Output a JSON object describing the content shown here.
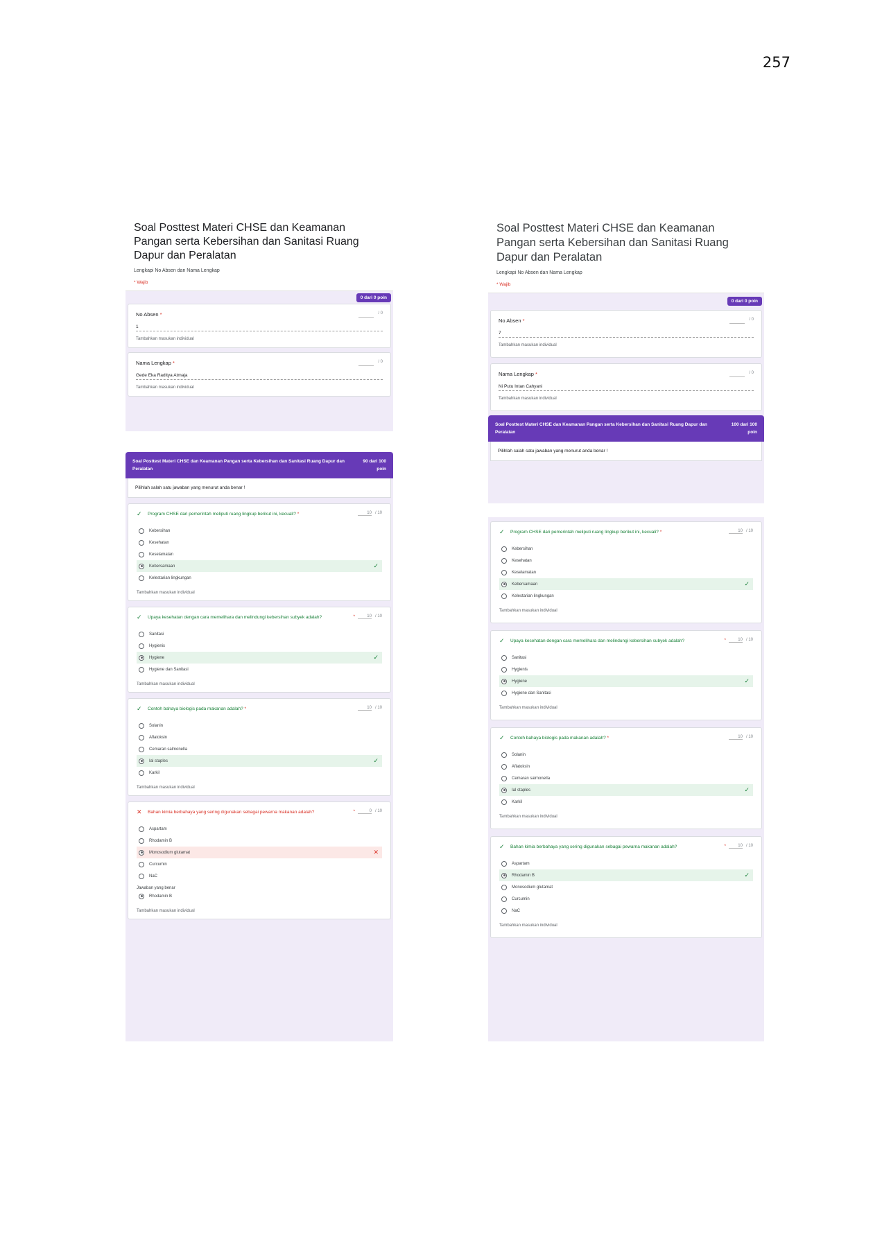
{
  "page_number": "257",
  "left": {
    "form_title": "Soal Posttest  Materi CHSE dan Keamanan Pangan serta Kebersihan dan Sanitasi Ruang Dapur dan Peralatan",
    "form_desc": "Lengkapi No Absen dan Nama Lengkap",
    "wajib": "* Wajib",
    "points_badge": "0 dari 0 poin",
    "no_absen": {
      "label": "No Absen",
      "req": "*",
      "score": "",
      "max": "/ 0",
      "value": "1",
      "feedback": "Tambahkan masukan individual"
    },
    "nama": {
      "label": "Nama Lengkap",
      "req": "*",
      "score": "",
      "max": "/ 0",
      "value": "Gede Eka Raditya Atmaja",
      "feedback": "Tambahkan masukan individual"
    },
    "section": {
      "title": "Soal Posttest  Materi CHSE dan Keamanan Pangan serta Kebersihan dan Sanitasi Ruang Dapur dan Peralatan",
      "points": "90 dari 100 poin",
      "desc": "Pilihlah salah satu jawaban yang menurut anda benar !"
    },
    "questions": [
      {
        "mark": "✓",
        "text": "Program CHSE dari pemerintah meliputi ruang lingkup berikut ini, kecuali?",
        "req": "*",
        "score": "10",
        "max": "/ 10",
        "options": [
          "Kebersihan",
          "Kesehatan",
          "Keselamatan",
          "Kebersamaan",
          "Kelestarian lingkungan"
        ],
        "feedback": "Tambahkan masukan individual"
      },
      {
        "mark": "✓",
        "text": "Upaya kesehatan dengan cara memelihara dan melindungi kebersihan subyek adalah?",
        "req": "*",
        "score": "10",
        "max": "/ 10",
        "options": [
          "Sanitasi",
          "Hygienis",
          "Hygiene",
          "Hygiene dan Sanitasi"
        ],
        "feedback": "Tambahkan masukan individual"
      },
      {
        "mark": "✓",
        "text": "Contoh bahaya biologis pada makanan adalah?",
        "req": "*",
        "score": "10",
        "max": "/ 10",
        "options": [
          "Solanin",
          "Aflatoksin",
          "Cemaran salmonella",
          "Ial staples",
          "Karkil"
        ],
        "feedback": "Tambahkan masukan individual"
      },
      {
        "mark": "✕",
        "text": "Bahan kimia berbahaya yang sering digunakan sebagai pewarna makanan adalah?",
        "req": "*",
        "score": "0",
        "max": "/ 10",
        "options": [
          "Aspartam",
          "Rhodamin B",
          "Monosodium glutamat",
          "Curcumin",
          "NaC"
        ],
        "correct_label": "Jawaban yang benar",
        "correct_answer": "Rhodamin B",
        "feedback": "Tambahkan masukan individual"
      }
    ]
  },
  "right": {
    "form_title": "Soal Posttest  Materi CHSE dan Keamanan Pangan serta Kebersihan dan Sanitasi Ruang Dapur dan Peralatan",
    "form_desc": "Lengkapi No Absen dan Nama Lengkap",
    "wajib": "* Wajib",
    "points_badge": "0 dari 0 poin",
    "no_absen": {
      "label": "No Absen",
      "req": "*",
      "score": "",
      "max": "/ 0",
      "value": "7",
      "feedback": "Tambahkan masukan individual"
    },
    "nama": {
      "label": "Nama Lengkap",
      "req": "*",
      "score": "",
      "max": "/ 0",
      "value": "Ni Putu Intan Cahyani",
      "feedback": "Tambahkan masukan individual"
    },
    "section": {
      "title": "Soal Posttest  Materi CHSE dan Keamanan Pangan serta Kebersihan dan Sanitasi Ruang Dapur dan Peralatan",
      "points": "100 dari 100 poin",
      "desc": "Pilihlah salah satu jawaban yang menurut anda benar !"
    },
    "questions": [
      {
        "mark": "✓",
        "text": "Program CHSE dari pemerintah meliputi ruang lingkup berikut ini, kecuali?",
        "req": "*",
        "score": "10",
        "max": "/ 10",
        "options": [
          "Kebersihan",
          "Kesehatan",
          "Keselamatan",
          "Kebersamaan",
          "Kelestarian lingkungan"
        ],
        "feedback": "Tambahkan masukan individual"
      },
      {
        "mark": "✓",
        "text": "Upaya kesehatan dengan cara memelihara dan melindungi kebersihan subyek adalah?",
        "req": "*",
        "score": "10",
        "max": "/ 10",
        "options": [
          "Sanitasi",
          "Hygienis",
          "Hygiene",
          "Hygiene dan Sanitasi"
        ],
        "feedback": "Tambahkan masukan individual"
      },
      {
        "mark": "✓",
        "text": "Contoh bahaya biologis pada makanan adalah?",
        "req": "*",
        "score": "10",
        "max": "/ 10",
        "options": [
          "Solanin",
          "Aflatoksin",
          "Cemaran salmonella",
          "Ial staples",
          "Karkil"
        ],
        "feedback": "Tambahkan masukan individual"
      },
      {
        "mark": "✓",
        "text": "Bahan kimia berbahaya yang sering digunakan sebagai pewarna makanan adalah?",
        "req": "*",
        "score": "10",
        "max": "/ 10",
        "options": [
          "Aspartam",
          "Rhodamin B",
          "Monosodium glutamat",
          "Curcumin",
          "NaC"
        ],
        "feedback": "Tambahkan masukan individual"
      }
    ]
  }
}
